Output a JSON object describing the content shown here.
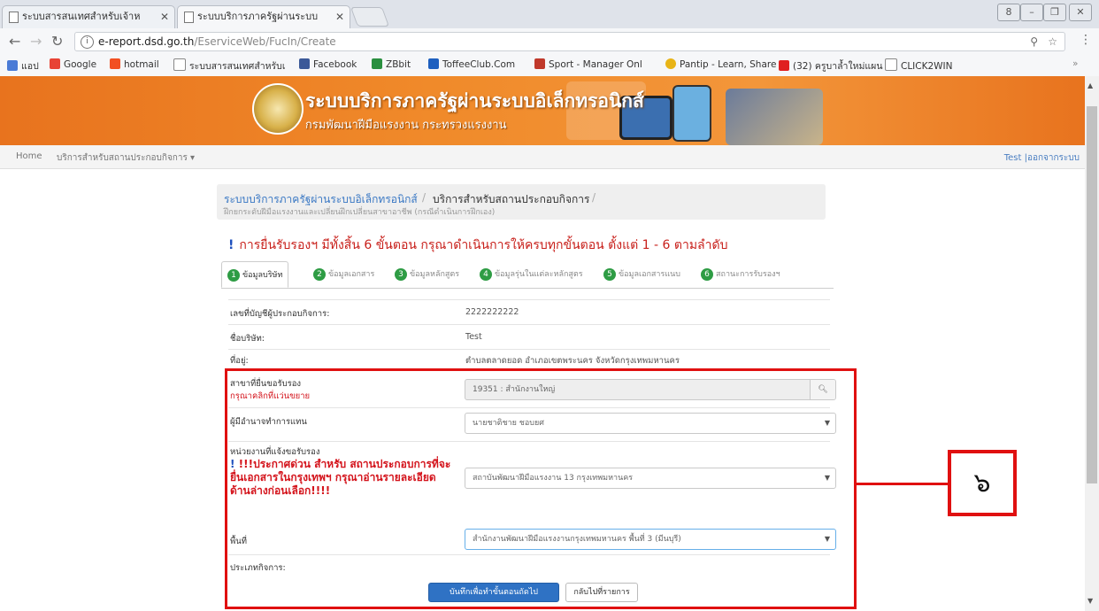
{
  "browser": {
    "tabs": [
      {
        "title": "ระบบสารสนเทศสำหรับเจ้าห"
      },
      {
        "title": "ระบบบริการภาครัฐผ่านระบบ"
      }
    ],
    "window_controls": [
      "8",
      "–",
      "❐",
      "✕"
    ],
    "url_host": "e-report.dsd.go.th",
    "url_path": "/EserviceWeb/FucIn/Create",
    "bookmarks": [
      {
        "label": "แอป",
        "color": "#4a7bd6"
      },
      {
        "label": "Google",
        "color": "#e84335"
      },
      {
        "label": "hotmail",
        "color": "#f25022"
      },
      {
        "label": "ระบบสารสนเทศสำหรับเ",
        "color": "#bbbbbb"
      },
      {
        "label": "Facebook",
        "color": "#3b5998"
      },
      {
        "label": "ZBbit",
        "color": "#2a8f3f"
      },
      {
        "label": "ToffeeClub.Com",
        "color": "#1e5fbf"
      },
      {
        "label": "Sport - Manager Onl",
        "color": "#c0392b"
      },
      {
        "label": "Pantip - Learn, Share",
        "color": "#e8b417"
      },
      {
        "label": "(32) ครูบาล้ำใหม่แผน",
        "color": "#e02020"
      },
      {
        "label": "CLICK2WIN",
        "color": "#bbbbbb"
      }
    ]
  },
  "site": {
    "title": "ระบบบริการภาครัฐผ่านระบบอิเล็กทรอนิกส์",
    "subtitle": "กรมพัฒนาฝีมือแรงงาน กระทรวงแรงงาน",
    "nav": {
      "home": "Home",
      "services": "บริการสำหรับสถานประกอบกิจการ ▾",
      "user": "Test |ออกจากระบบ"
    }
  },
  "breadcrumb": {
    "link": "ระบบบริการภาครัฐผ่านระบบอิเล็กทรอนิกส์",
    "sep": "/",
    "current": "บริการสำหรับสถานประกอบกิจการ",
    "sub": "ฝึกยกระดับฝีมือแรงงานและเปลี่ยนฝึกเปลี่ยนสาขาอาชีพ (กรณีดำเนินการฝึกเอง)"
  },
  "warning": "การยื่นรับรองฯ มีทั้งสิ้น 6 ขั้นตอน กรุณาดำเนินการให้ครบทุกขั้นตอน ตั้งแต่ 1 - 6 ตามลำดับ",
  "steps": [
    {
      "n": "1",
      "label": "ข้อมูลบริษัท"
    },
    {
      "n": "2",
      "label": "ข้อมูลเอกสาร"
    },
    {
      "n": "3",
      "label": "ข้อมูลหลักสูตร"
    },
    {
      "n": "4",
      "label": "ข้อมูลรุ่นในแต่ละหลักสูตร"
    },
    {
      "n": "5",
      "label": "ข้อมูลเอกสารแนบ"
    },
    {
      "n": "6",
      "label": "สถานะการรับรองฯ"
    }
  ],
  "info": {
    "employer_id_label": "เลขที่บัญชีผู้ประกอบกิจการ:",
    "employer_id_value": "2222222222",
    "company_label": "ชื่อบริษัท:",
    "company_value": "Test",
    "address_label": "ที่อยู่:",
    "address_value": "ตำบลตลาดยอด อำเภอเขตพระนคร จังหวัดกรุงเทพมหานคร"
  },
  "form": {
    "branch_label": "สาขาที่ยื่นขอรับรอง",
    "branch_hint": "กรุณาคลิกที่แว่นขยาย",
    "branch_value": "19351 : สำนักงานใหญ่",
    "authorized_label": "ผู้มีอำนาจทำการแทน",
    "authorized_value": "นายชาติชาย ชอบยศ",
    "agency_label": "หน่วยงานที่แจ้งขอรับรอง",
    "agency_notice": "!!!ประกาศด่วน สำหรับ สถานประกอบการที่จะยื่นเอกสารในกรุงเทพฯ กรุณาอ่านรายละเอียดด้านล่างก่อนเลือก!!!!",
    "agency_value": "สถาบันพัฒนาฝีมือแรงงาน 13 กรุงเทพมหานคร",
    "area_label": "พื้นที่",
    "area_value": "สำนักงานพัฒนาฝีมือแรงงานกรุงเทพมหานคร พื้นที่ 3 (มีนบุรี)",
    "business_type_label": "ประเภทกิจการ:",
    "save_button": "บันทึกเพื่อทำขั้นตอนถัดไป",
    "back_button": "กลับไปที่รายการ"
  },
  "annotation": {
    "label": "๖",
    "color": "#e01010"
  }
}
